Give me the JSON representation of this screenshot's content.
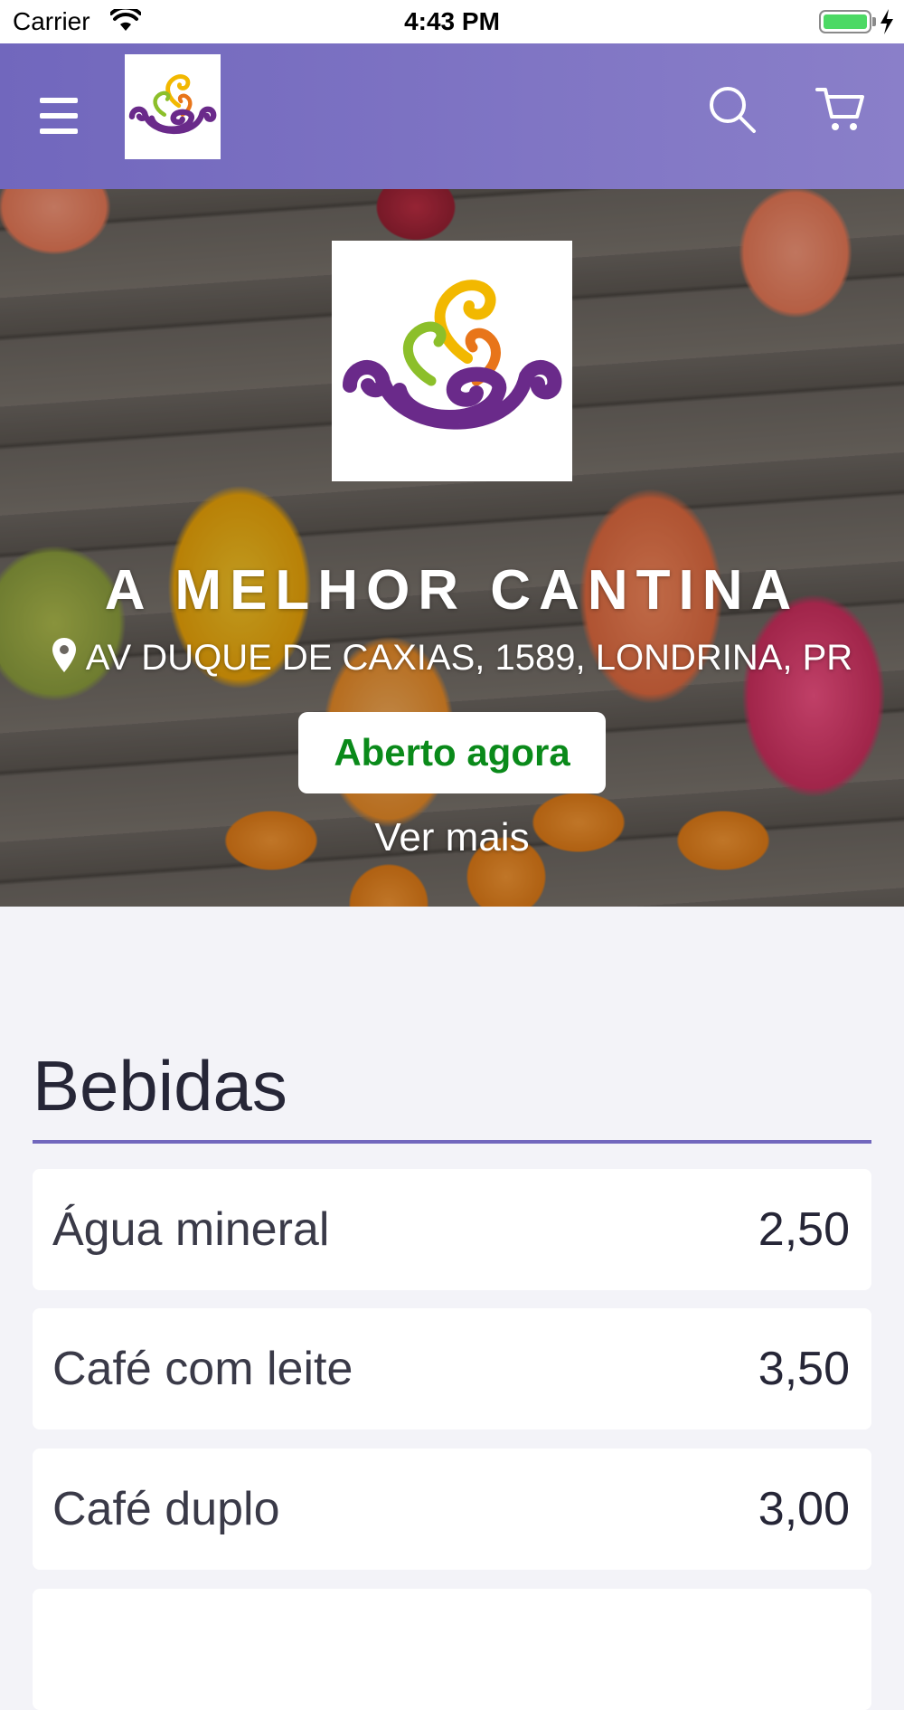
{
  "status_bar": {
    "carrier": "Carrier",
    "time": "4:43 PM"
  },
  "header": {
    "menu_icon": "hamburger-menu-icon",
    "logo_icon": "cantina-logo",
    "search_icon": "search-icon",
    "cart_icon": "cart-icon",
    "color": "#7a70c4"
  },
  "store": {
    "name": "A MELHOR CANTINA",
    "address": "AV DUQUE DE CAXIAS, 1589, LONDRINA, PR",
    "status": "Aberto agora",
    "status_color": "#0a8a1a",
    "see_more": "Ver mais"
  },
  "menu": {
    "section_title": "Bebidas",
    "accent": "#7167bd",
    "items": [
      {
        "name": "Água mineral",
        "price": "2,50"
      },
      {
        "name": "Café com leite",
        "price": "3,50"
      },
      {
        "name": "Café duplo",
        "price": "3,00"
      }
    ]
  }
}
